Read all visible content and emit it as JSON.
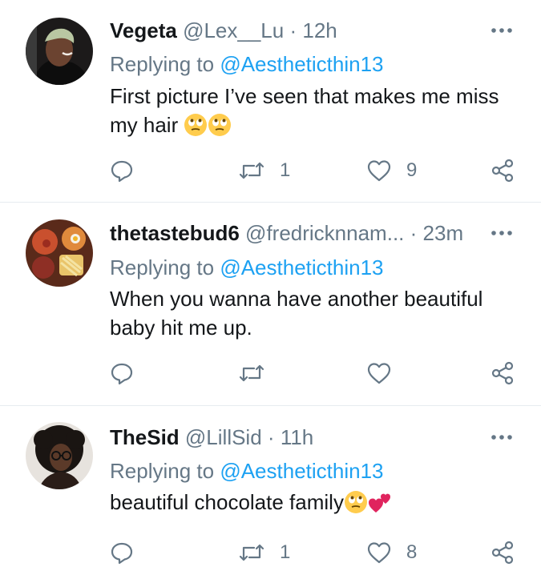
{
  "tweets": [
    {
      "display_name": "Vegeta",
      "handle": "@Lex__Lu",
      "separator": "·",
      "time": "12h",
      "replying_prefix": "Replying to",
      "replying_to": "@Aestheticthin13",
      "text": "First picture I’ve seen that makes me miss my hair",
      "emojis": [
        "face-with-rolling-eyes",
        "face-with-rolling-eyes"
      ],
      "retweets": "1",
      "likes": "9"
    },
    {
      "display_name": "thetastebud6",
      "handle": "@fredricknnam...",
      "separator": "·",
      "time": "23m",
      "replying_prefix": "Replying to",
      "replying_to": "@Aestheticthin13",
      "text": "When you wanna have another beautiful baby hit me up.",
      "emojis": [],
      "retweets": "",
      "likes": ""
    },
    {
      "display_name": "TheSid",
      "handle": "@LillSid",
      "separator": "·",
      "time": "11h",
      "replying_prefix": "Replying to",
      "replying_to": "@Aestheticthin13",
      "text": "beautiful chocolate family",
      "emojis": [
        "face-with-rolling-eyes",
        "two-hearts"
      ],
      "retweets": "1",
      "likes": "8"
    }
  ],
  "colors": {
    "text": "#14171a",
    "secondary": "#657786",
    "mention": "#1da1f2",
    "divider": "#e6ecf0",
    "emoji_face": "#ffcc4d",
    "heart": "#e0245e"
  }
}
